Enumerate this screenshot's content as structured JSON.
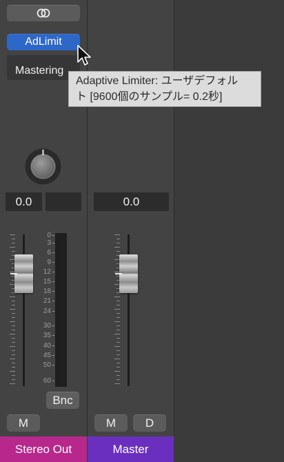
{
  "strips": [
    {
      "plugin_label": "AdLimit",
      "slot_label": "Mastering",
      "pan_value": "0.0",
      "meter_scale": [
        "0",
        "3",
        "6",
        "9",
        "12",
        "15",
        "18",
        "21",
        "24",
        "30",
        "35",
        "40",
        "45",
        "50",
        "60"
      ],
      "output_button": "Bnc",
      "mute_label": "M",
      "name": "Stereo Out",
      "name_color": "#b8288c"
    },
    {
      "volume_value": "0.0",
      "mute_label": "M",
      "dim_label": "D",
      "name": "Master",
      "name_color": "#6a2fbf"
    }
  ],
  "tooltip": {
    "line1": "Adaptive Limiter: ユーザデフォル",
    "line2": "ト [9600個のサンプル= 0.2秒]"
  },
  "colors": {
    "plugin_active": "#2d67c8",
    "background": "#3d3d3d"
  },
  "icons": [
    "link-icon",
    "pointer-cursor-icon"
  ]
}
